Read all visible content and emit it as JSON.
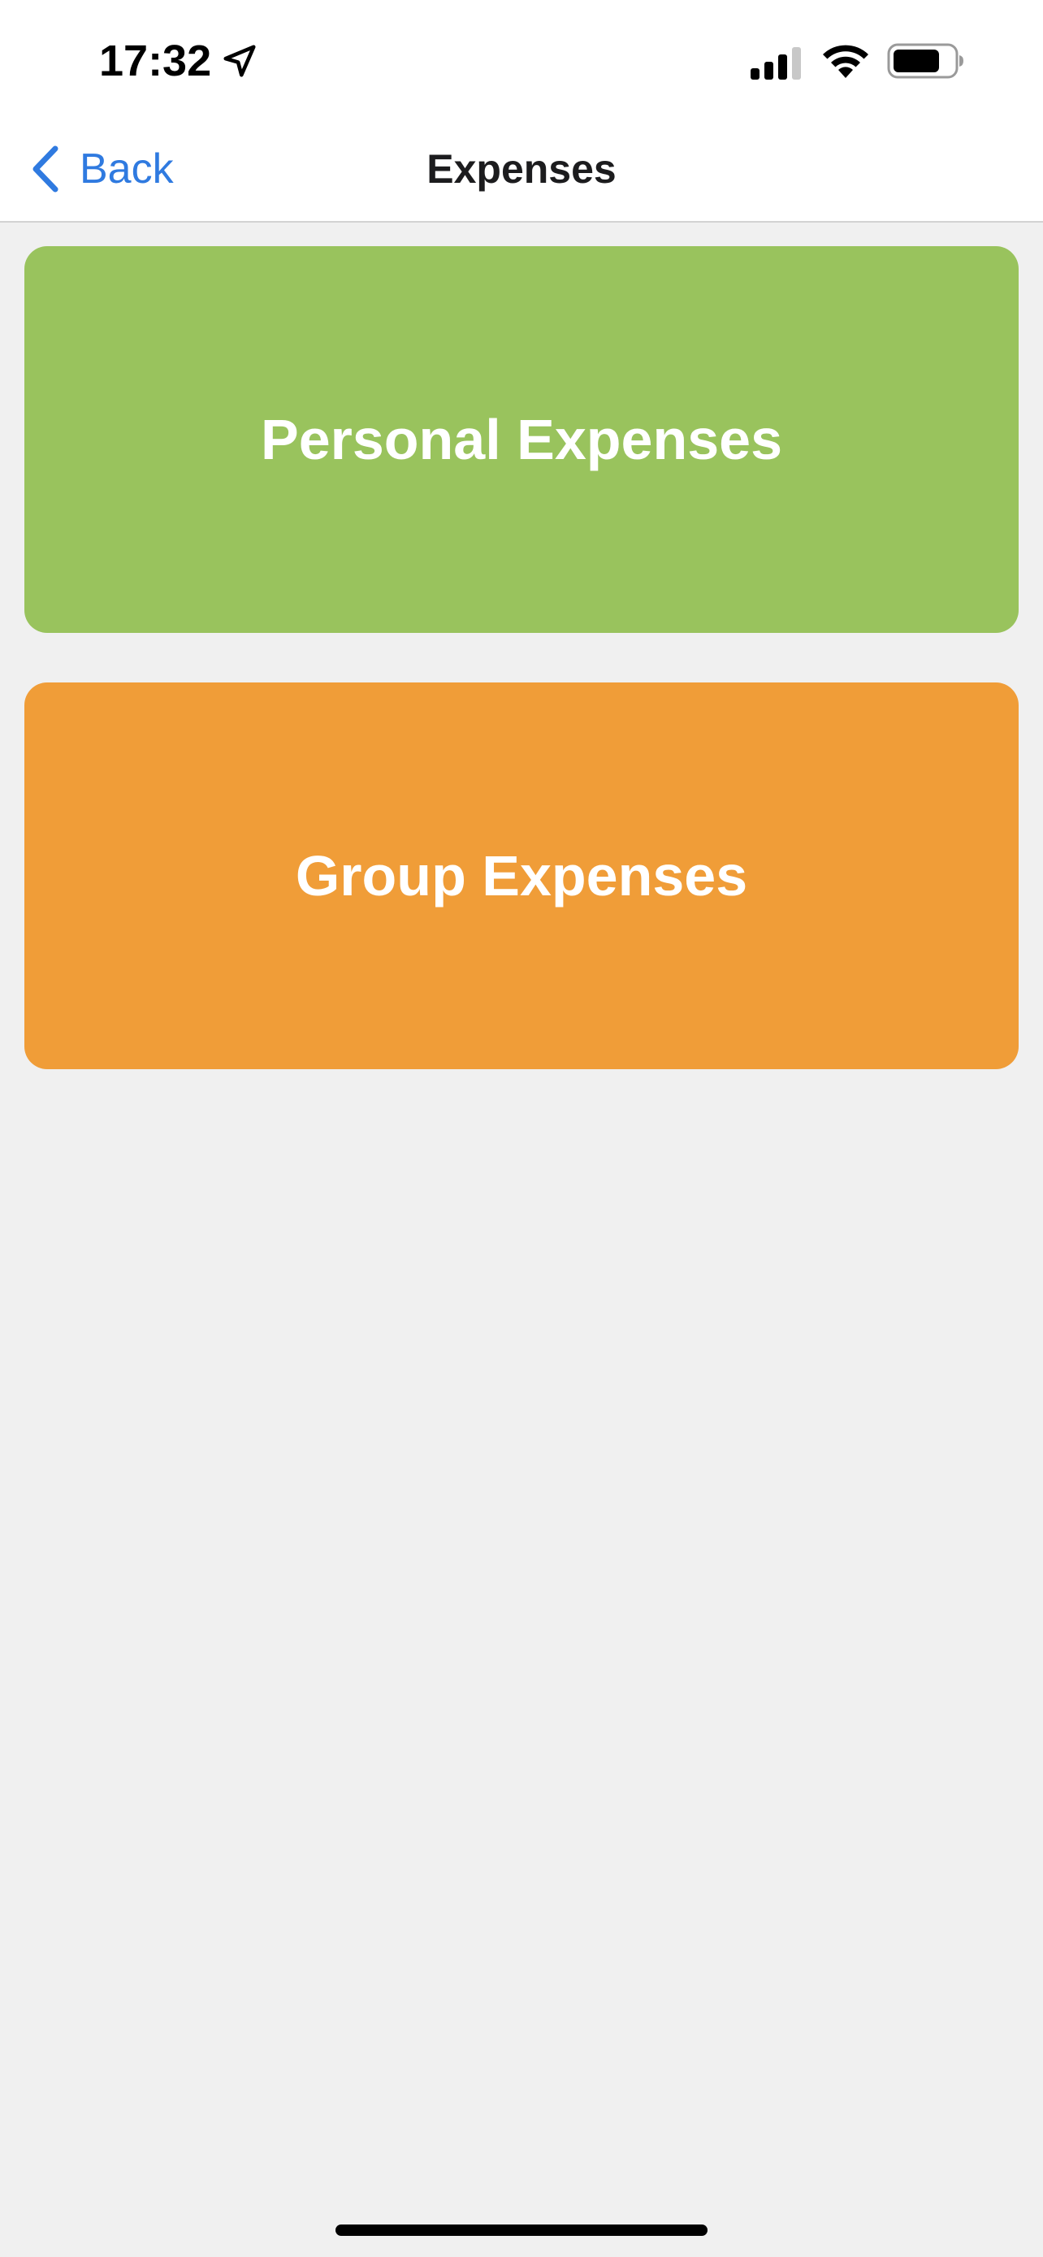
{
  "status_bar": {
    "time": "17:32",
    "icons": [
      "location-arrow-icon",
      "cellular-signal-icon",
      "wifi-icon",
      "battery-icon"
    ]
  },
  "nav": {
    "back_label": "Back",
    "title": "Expenses",
    "back_icon": "chevron-left-icon",
    "accent_color": "#2f7ae0"
  },
  "cards": [
    {
      "label": "Personal Expenses",
      "color": "#99c35d"
    },
    {
      "label": "Group Expenses",
      "color": "#f09d38"
    }
  ]
}
